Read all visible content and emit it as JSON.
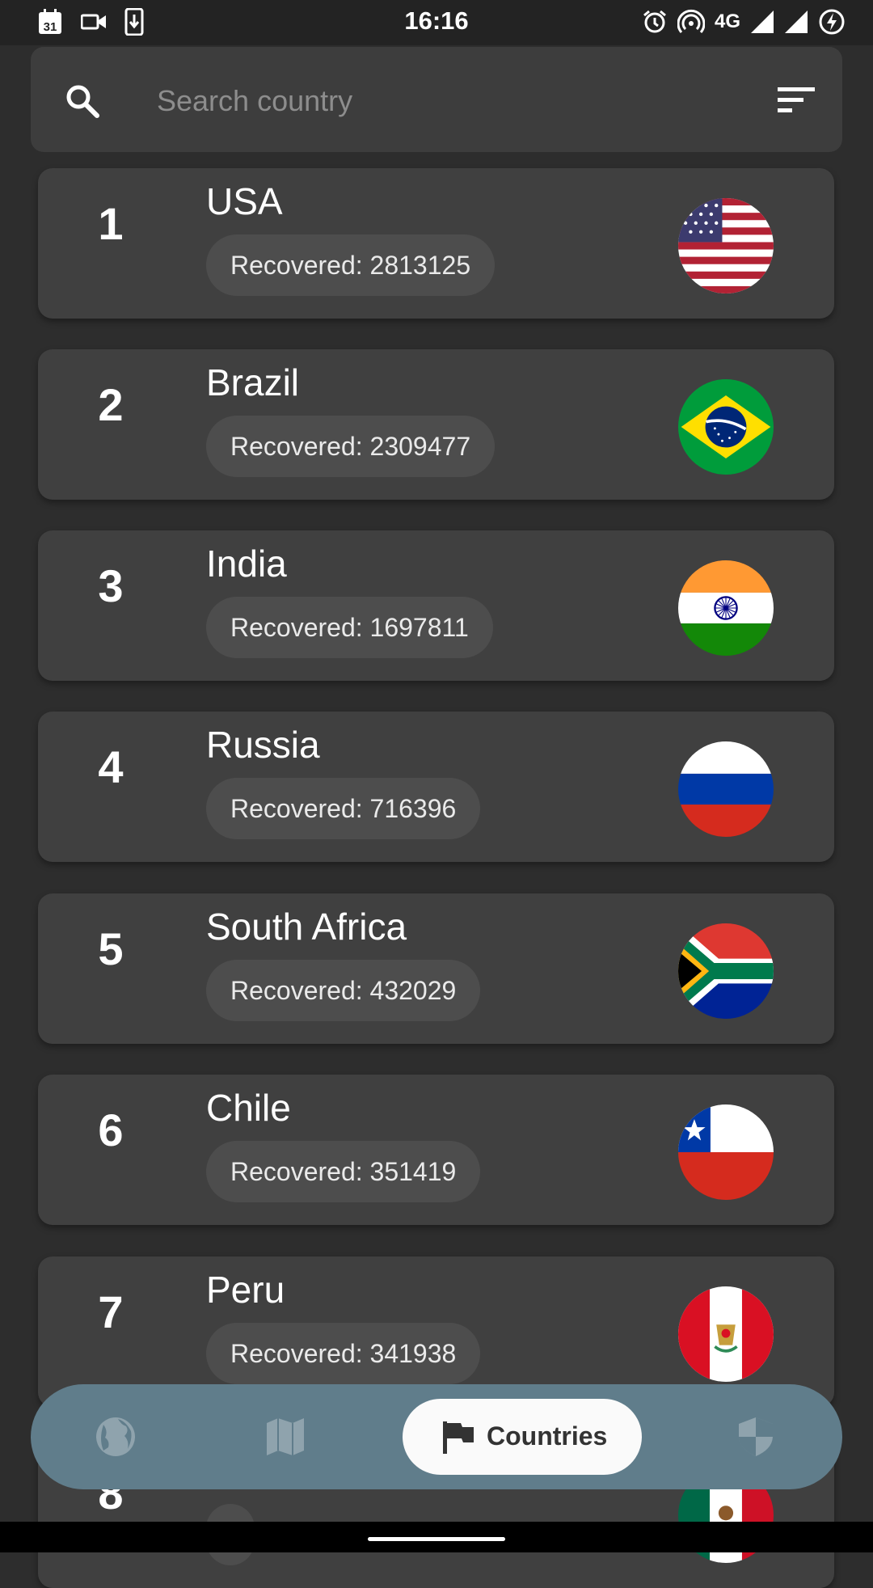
{
  "status_bar": {
    "time": "16:16",
    "calendar_day": "31",
    "network": "4G",
    "left_icons": [
      "calendar-icon",
      "video-camera-icon",
      "download-icon"
    ],
    "right_icons": [
      "alarm-icon",
      "hotspot-icon",
      "signal-icon",
      "signal-icon",
      "battery-saver-icon"
    ]
  },
  "search": {
    "placeholder": "Search country",
    "value": "",
    "icon": "search-icon",
    "filter_icon": "filter-icon"
  },
  "countries": [
    {
      "rank": "1",
      "name": "USA",
      "recovered": "Recovered: 2813125",
      "flag": "usa-flag"
    },
    {
      "rank": "2",
      "name": "Brazil",
      "recovered": "Recovered: 2309477",
      "flag": "brazil-flag"
    },
    {
      "rank": "3",
      "name": "India",
      "recovered": "Recovered: 1697811",
      "flag": "india-flag"
    },
    {
      "rank": "4",
      "name": "Russia",
      "recovered": "Recovered: 716396",
      "flag": "russia-flag"
    },
    {
      "rank": "5",
      "name": "South Africa",
      "recovered": "Recovered: 432029",
      "flag": "south-africa-flag"
    },
    {
      "rank": "6",
      "name": "Chile",
      "recovered": "Recovered: 351419",
      "flag": "chile-flag"
    },
    {
      "rank": "7",
      "name": "Peru",
      "recovered": "Recovered: 341938",
      "flag": "peru-flag"
    },
    {
      "rank": "8",
      "name": "",
      "recovered": "",
      "flag": "mexico-flag"
    }
  ],
  "bottom_nav": {
    "items": [
      {
        "icon": "globe-icon",
        "label": ""
      },
      {
        "icon": "map-icon",
        "label": ""
      },
      {
        "icon": "flag-icon",
        "label": "Countries",
        "active": true
      },
      {
        "icon": "shield-icon",
        "label": ""
      }
    ]
  },
  "colors": {
    "background": "#2d2d2d",
    "card": "#404040",
    "chip": "#4d4d4d",
    "nav_bar": "#607d8b",
    "nav_active": "#fafafa"
  }
}
